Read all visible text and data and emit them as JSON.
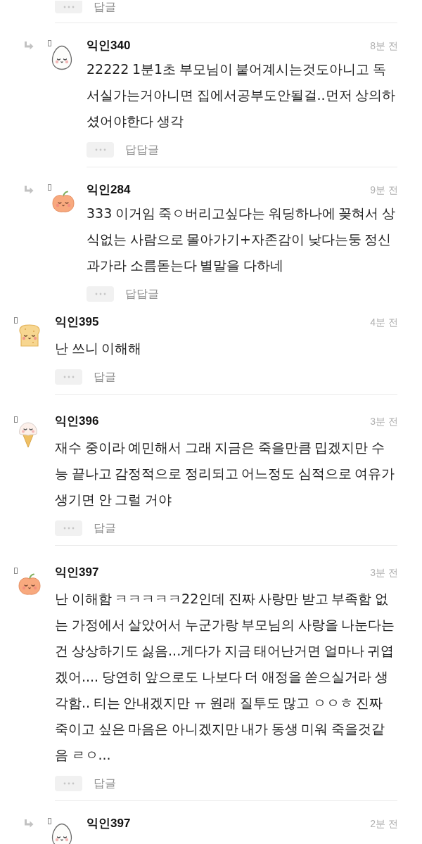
{
  "panels": [
    {
      "partial_footer": {
        "reply_label": "답글"
      },
      "comments": [
        {
          "kind": "reply",
          "avatar": {
            "kind": "egg"
          },
          "author": "익인340",
          "time": "8분 전",
          "text": "22222 1분1초 부모님이 붙어계시는것도아니고 독서실가는거아니면 집에서공부도안될걸..먼저 상의하셨어야한다 생각",
          "reply_label": "답답글"
        },
        {
          "kind": "reply",
          "avatar": {
            "kind": "pumpkin"
          },
          "author": "익인284",
          "time": "9분 전",
          "text": "333 이거임 죽ㅇ버리고싶다는 워딩하나에 꽂혀서 상식없는 사람으로 몰아가기+자존감이 낮다는둥 정신과가라 소름돋는다 별말을 다하네",
          "reply_label": "답답글"
        }
      ]
    },
    {
      "comments": [
        {
          "kind": "comment",
          "avatar": {
            "kind": "toast"
          },
          "author": "익인395",
          "time": "4분 전",
          "text": "난 쓰니 이해해",
          "reply_label": "답글"
        },
        {
          "kind": "comment",
          "avatar": {
            "kind": "ice_cream"
          },
          "author": "익인396",
          "time": "3분 전",
          "text": "재수 중이라 예민해서 그래 지금은 죽을만큼 밉겠지만 수능 끝나고 감정적으로 정리되고 어느정도 심적으로 여유가 생기면 안 그럴 거야",
          "reply_label": "답글"
        },
        {
          "kind": "comment",
          "avatar": {
            "kind": "pumpkin"
          },
          "author": "익인397",
          "time": "3분 전",
          "text": "난 이해함 ㅋㅋㅋㅋㅋ22인데 진짜 사랑만 받고 부족함 없는 가정에서 살았어서 누군가랑 부모님의 사랑을 나눈다는건 상상하기도 싫음...게다가 지금 태어난거면 얼마나 귀엽겠어.... 당연히 앞으로도 나보다 더 애정을 쏟으실거라 생각함.. 티는 안내겠지만 ㅠ 원래 질투도 많고 ㅇㅇㅎ 진짜 죽이고 싶은 마음은 아니겠지만 내가 동생 미워 죽을것같음 ㄹㅇ...",
          "reply_label": "답글"
        },
        {
          "kind": "reply",
          "avatar": {
            "kind": "egg"
          },
          "author": "익인397",
          "time": "2분 전"
        }
      ]
    }
  ]
}
